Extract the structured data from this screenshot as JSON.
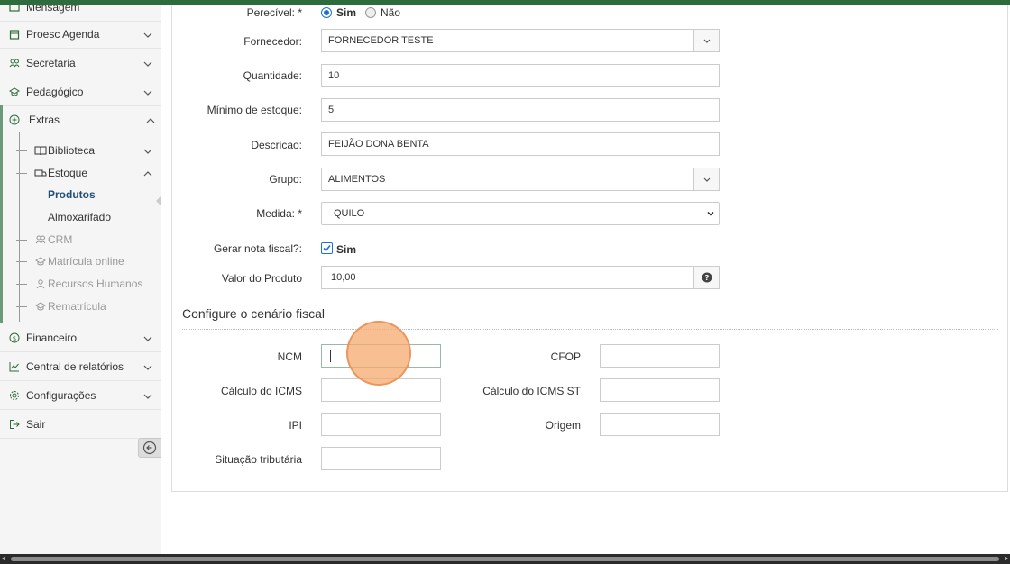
{
  "sidebar": {
    "top_partial": "Mensagem",
    "items": [
      {
        "label": "Proesc Agenda"
      },
      {
        "label": "Secretaria"
      },
      {
        "label": "Pedagógico"
      },
      {
        "label": "Extras"
      },
      {
        "label": "Financeiro"
      },
      {
        "label": "Central de relatórios"
      },
      {
        "label": "Configurações"
      },
      {
        "label": "Sair"
      }
    ],
    "extras_sub": {
      "biblioteca": "Biblioteca",
      "estoque": "Estoque",
      "produtos": "Produtos",
      "almoxarifado": "Almoxarifado",
      "crm": "CRM",
      "matricula": "Matrícula online",
      "rh": "Recursos Humanos",
      "rematricula": "Rematrícula"
    }
  },
  "form": {
    "perecivel": {
      "label": "Perecível:",
      "req": "*",
      "opt_yes": "Sim",
      "opt_no": "Não",
      "selected": "Sim"
    },
    "fornecedor": {
      "label": "Fornecedor:",
      "value": "FORNECEDOR TESTE"
    },
    "quantidade": {
      "label": "Quantidade:",
      "value": "10"
    },
    "minimo": {
      "label": "Mínimo de estoque:",
      "value": "5"
    },
    "descricao": {
      "label": "Descricao:",
      "value": "FEIJÃO DONA BENTA"
    },
    "grupo": {
      "label": "Grupo:",
      "value": "ALIMENTOS"
    },
    "medida": {
      "label": "Medida:",
      "req": "*",
      "value": "QUILO"
    },
    "nota_fiscal": {
      "label": "Gerar nota fiscal?:",
      "check_label": "Sim",
      "checked": true
    },
    "valor": {
      "label": "Valor do Produto",
      "value": "10,00"
    }
  },
  "fiscal": {
    "title": "Configure o cenário fiscal",
    "ncm": {
      "label": "NCM",
      "value": ""
    },
    "cfop": {
      "label": "CFOP",
      "value": ""
    },
    "icms": {
      "label": "Cálculo do ICMS",
      "value": ""
    },
    "icms_st": {
      "label": "Cálculo do ICMS ST",
      "value": ""
    },
    "ipi": {
      "label": "IPI",
      "value": ""
    },
    "origem": {
      "label": "Origem",
      "value": ""
    },
    "situacao": {
      "label": "Situação tributária",
      "value": ""
    }
  },
  "colors": {
    "brand": "#2e6b3d",
    "accent": "#1e6fd9"
  }
}
